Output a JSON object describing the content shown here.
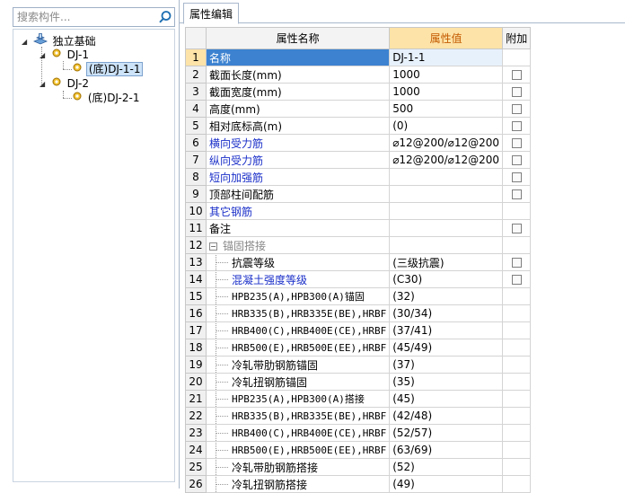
{
  "search": {
    "placeholder": "搜索构件..."
  },
  "tree": {
    "root": "独立基础",
    "nodes": [
      {
        "label": "DJ-1",
        "children": [
          {
            "label": "(底)DJ-1-1",
            "selected": true
          }
        ]
      },
      {
        "label": "DJ-2",
        "children": [
          {
            "label": "(底)DJ-2-1",
            "selected": false
          }
        ]
      }
    ]
  },
  "tab": {
    "label": "属性编辑"
  },
  "grid": {
    "headers": {
      "name": "属性名称",
      "value": "属性值",
      "extra": "附加"
    },
    "rows": [
      {
        "num": "1",
        "name": "名称",
        "value": "DJ-1-1",
        "style": "",
        "cb": false
      },
      {
        "num": "2",
        "name": "截面长度(mm)",
        "value": "1000",
        "style": "",
        "cb": true
      },
      {
        "num": "3",
        "name": "截面宽度(mm)",
        "value": "1000",
        "style": "",
        "cb": true
      },
      {
        "num": "4",
        "name": "高度(mm)",
        "value": "500",
        "style": "",
        "cb": true
      },
      {
        "num": "5",
        "name": "相对底标高(m)",
        "value": "(0)",
        "style": "",
        "cb": true
      },
      {
        "num": "6",
        "name": "横向受力筋",
        "value": "⌀12@200/⌀12@200",
        "style": "blue",
        "cb": true
      },
      {
        "num": "7",
        "name": "纵向受力筋",
        "value": "⌀12@200/⌀12@200",
        "style": "blue",
        "cb": true
      },
      {
        "num": "8",
        "name": "短向加强筋",
        "value": "",
        "style": "blue",
        "cb": true
      },
      {
        "num": "9",
        "name": "顶部柱间配筋",
        "value": "",
        "style": "",
        "cb": true
      },
      {
        "num": "10",
        "name": "其它钢筋",
        "value": "",
        "style": "blue",
        "cb": false
      },
      {
        "num": "11",
        "name": "备注",
        "value": "",
        "style": "",
        "cb": true
      },
      {
        "num": "12",
        "name": "锚固搭接",
        "value": "",
        "style": "gray group",
        "cb": false
      },
      {
        "num": "13",
        "name": "抗震等级",
        "value": "(三级抗震)",
        "style": "sub",
        "cb": true
      },
      {
        "num": "14",
        "name": "混凝土强度等级",
        "value": "(C30)",
        "style": "sub blue",
        "cb": true
      },
      {
        "num": "15",
        "name": "HPB235(A),HPB300(A)锚固",
        "value": "(32)",
        "style": "sub mono",
        "cb": false
      },
      {
        "num": "16",
        "name": "HRB335(B),HRB335E(BE),HRBF",
        "value": "(30/34)",
        "style": "sub mono",
        "cb": false
      },
      {
        "num": "17",
        "name": "HRB400(C),HRB400E(CE),HRBF",
        "value": "(37/41)",
        "style": "sub mono",
        "cb": false
      },
      {
        "num": "18",
        "name": "HRB500(E),HRB500E(EE),HRBF",
        "value": "(45/49)",
        "style": "sub mono",
        "cb": false
      },
      {
        "num": "19",
        "name": "冷轧带肋钢筋锚固",
        "value": "(37)",
        "style": "sub",
        "cb": false
      },
      {
        "num": "20",
        "name": "冷轧扭钢筋锚固",
        "value": "(35)",
        "style": "sub",
        "cb": false
      },
      {
        "num": "21",
        "name": "HPB235(A),HPB300(A)搭接",
        "value": "(45)",
        "style": "sub mono",
        "cb": false
      },
      {
        "num": "22",
        "name": "HRB335(B),HRB335E(BE),HRBF",
        "value": "(42/48)",
        "style": "sub mono",
        "cb": false
      },
      {
        "num": "23",
        "name": "HRB400(C),HRB400E(CE),HRBF",
        "value": "(52/57)",
        "style": "sub mono",
        "cb": false
      },
      {
        "num": "24",
        "name": "HRB500(E),HRB500E(EE),HRBF",
        "value": "(63/69)",
        "style": "sub mono",
        "cb": false
      },
      {
        "num": "25",
        "name": "冷轧带肋钢筋搭接",
        "value": "(52)",
        "style": "sub",
        "cb": false
      },
      {
        "num": "26",
        "name": "冷轧扭钢筋搭接",
        "value": "(49)",
        "style": "sub",
        "cb": false
      }
    ]
  }
}
